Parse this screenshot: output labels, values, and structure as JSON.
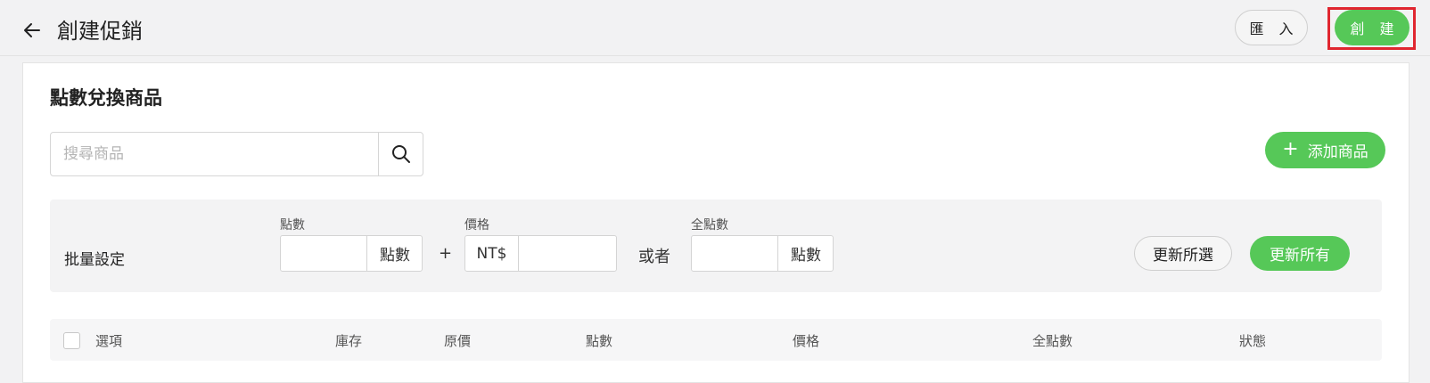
{
  "header": {
    "title": "創建促銷",
    "import_label": "匯 入",
    "create_label": "創 建"
  },
  "section": {
    "title": "點數兌換商品",
    "search_placeholder": "搜尋商品",
    "search_value": "",
    "add_product_label": "添加商品",
    "add_icon": "plus-icon",
    "search_icon": "search-icon"
  },
  "bulk": {
    "label": "批量設定",
    "points_label": "點數",
    "points_value": "",
    "points_unit": "點數",
    "plus_sign": "+",
    "price_label": "價格",
    "price_currency": "NT$",
    "price_value": "",
    "or_label": "或者",
    "full_points_label": "全點數",
    "full_points_value": "",
    "full_points_unit": "點數",
    "update_selected_label": "更新所選",
    "update_all_label": "更新所有"
  },
  "table": {
    "columns": [
      "選項",
      "庫存",
      "原價",
      "點數",
      "價格",
      "全點數",
      "狀態"
    ]
  },
  "colors": {
    "accent_green": "#56c858",
    "highlight_red": "#e0262f",
    "background": "#f2f2f3"
  }
}
